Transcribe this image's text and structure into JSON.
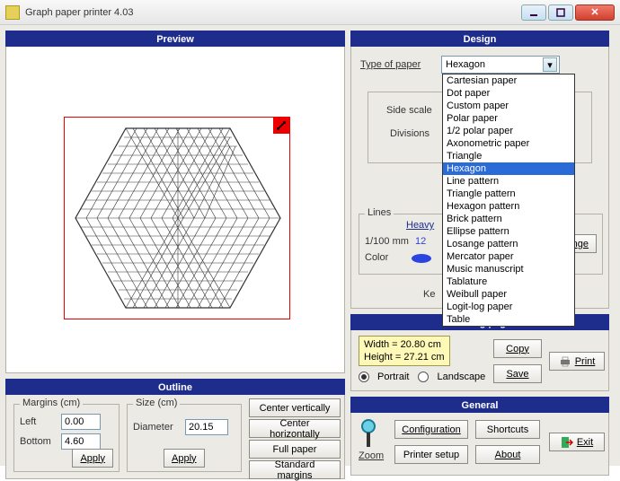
{
  "window": {
    "title": "Graph paper printer 4.03"
  },
  "preview": {
    "header": "Preview"
  },
  "outline": {
    "header": "Outline",
    "margins_group": "Margins (cm)",
    "left_label": "Left",
    "left_value": "0.00",
    "bottom_label": "Bottom",
    "bottom_value": "4.60",
    "apply1": "Apply",
    "size_group": "Size (cm)",
    "diameter_label": "Diameter",
    "diameter_value": "20.15",
    "apply2": "Apply",
    "center_v": "Center vertically",
    "center_h": "Center horizontally",
    "full_paper": "Full paper",
    "std_margins": "Standard margins"
  },
  "design": {
    "header": "Design",
    "type_label": "Type of paper",
    "type_value": "Hexagon",
    "options": [
      "Cartesian paper",
      "Dot paper",
      "Custom paper",
      "Polar paper",
      "1/2 polar paper",
      "Axonometric paper",
      "Triangle",
      "Hexagon",
      "Line pattern",
      "Triangle pattern",
      "Hexagon pattern",
      "Brick pattern",
      "Ellipse pattern",
      "Losange pattern",
      "Mercator paper",
      "Music manuscript",
      "Tablature",
      "Weibull paper",
      "Logit-log paper",
      "Table"
    ],
    "side_scale": "Side scale",
    "divisions": "Divisions",
    "lines_group": "Lines",
    "heavy": "Heavy",
    "mm_label": "1/100 mm",
    "mm_value": "12",
    "color_label": "Color",
    "change": "Change",
    "ke": "Ke",
    "printing_header": "Printing page",
    "width_line": "Width = 20.80 cm",
    "height_line": "Height = 27.21 cm",
    "portrait": "Portrait",
    "landscape": "Landscape",
    "copy": "Copy",
    "save": "Save",
    "print": "Print"
  },
  "general": {
    "header": "General",
    "zoom": "Zoom",
    "configuration": "Configuration",
    "printer_setup": "Printer setup",
    "shortcuts": "Shortcuts",
    "about": "About",
    "exit": "Exit"
  }
}
